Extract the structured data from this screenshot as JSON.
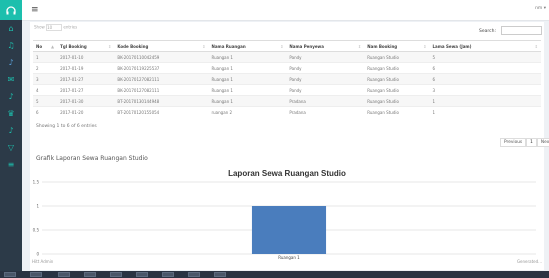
{
  "sidebar": {
    "items": [
      {
        "icon": "home-icon"
      },
      {
        "icon": "headphones-icon"
      },
      {
        "icon": "music-note-icon"
      },
      {
        "icon": "mail-icon"
      },
      {
        "icon": "mic-icon"
      },
      {
        "icon": "trophy-icon"
      },
      {
        "icon": "music-note-icon"
      },
      {
        "icon": "filter-icon"
      },
      {
        "icon": "list-icon"
      }
    ]
  },
  "topbar": {
    "user_label": "nm ▾"
  },
  "table": {
    "show_label": "Show",
    "show_value": "10",
    "entries_label": "entries",
    "search_label": "Search:",
    "search_value": "",
    "columns": [
      "No",
      "Tgl Booking",
      "Kode Booking",
      "Nama Ruangan",
      "Nama Penyewa",
      "Nam Booking",
      "Lama Sewa (Jam)"
    ],
    "rows": [
      [
        "1",
        "2017-01-10",
        "BK-20170110042459",
        "Ruangan 1",
        "Pandy",
        "Ruangan Studio",
        "5"
      ],
      [
        "2",
        "2017-01-19",
        "BK-20170119225537",
        "Ruangan 1",
        "Pandy",
        "Ruangan Studio",
        "6"
      ],
      [
        "3",
        "2017-01-27",
        "BK-20170127082111",
        "Ruangan 1",
        "Pandy",
        "Ruangan Studio",
        "6"
      ],
      [
        "4",
        "2017-01-27",
        "BK-20170127082111",
        "Ruangan 1",
        "Pandy",
        "Ruangan Studio",
        "3"
      ],
      [
        "5",
        "2017-01-30",
        "BT-20170130144948",
        "Ruangan 1",
        "Pradana",
        "Ruangan Studio",
        "1"
      ],
      [
        "6",
        "2017-01-20",
        "BT-20170120155054",
        "ruangan 2",
        "Pradana",
        "Ruangan Studio",
        "1"
      ]
    ],
    "info": "Showing 1 to 6 of 6 entries",
    "pager": {
      "prev": "Previous",
      "page": "1",
      "next": "Next"
    }
  },
  "chart_heading": "Grafik Laporan Sewa Ruangan Studio",
  "chart_data": {
    "type": "bar",
    "title": "Laporan Sewa Ruangan Studio",
    "categories": [
      "Ruangan 1"
    ],
    "values": [
      1
    ],
    "yticks": [
      "1.5",
      "1",
      "0.5",
      "0"
    ],
    "ylim": [
      0,
      1.5
    ],
    "grid": true,
    "color": "#4a7dbd",
    "footer_left": "Hitt Admin",
    "footer_right": "Generated..."
  },
  "colors": {
    "sidebar": "#2c3a48",
    "accent": "#1dbfad",
    "bar": "#4a7dbd"
  }
}
